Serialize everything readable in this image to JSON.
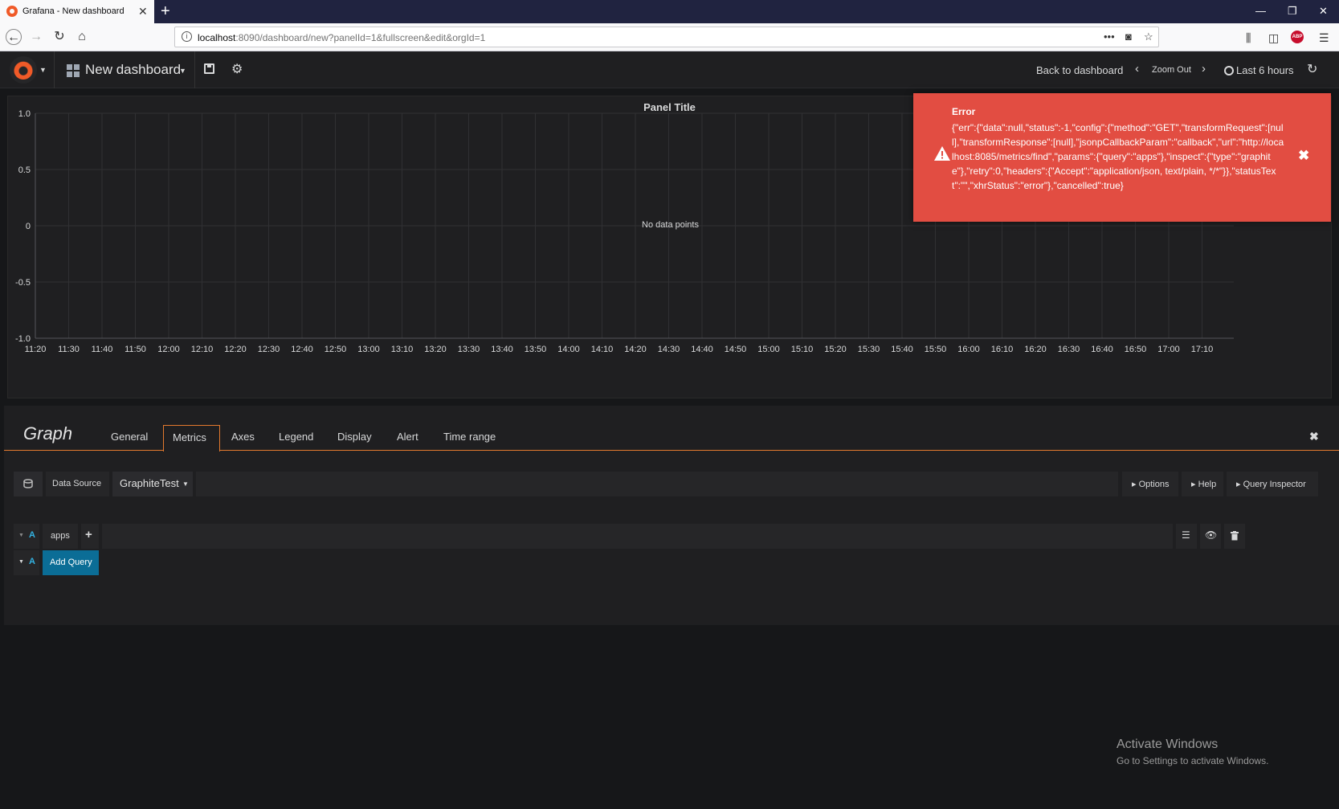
{
  "browser": {
    "tab_title": "Grafana - New dashboard",
    "url_host": "localhost",
    "url_path": ":8090/dashboard/new?panelId=1&fullscreen&edit&orgId=1",
    "addon_badge": "ABP"
  },
  "grafana_nav": {
    "dashboard_title": "New dashboard",
    "back_to_dashboard": "Back to dashboard",
    "zoom_out": "Zoom Out",
    "time_range": "Last 6 hours"
  },
  "panel": {
    "title": "Panel Title",
    "no_data": "No data points"
  },
  "chart_data": {
    "type": "line",
    "title": "Panel Title",
    "series": [],
    "y_ticks": [
      "1.0",
      "0.5",
      "0",
      "-0.5",
      "-1.0"
    ],
    "x_ticks": [
      "11:20",
      "11:30",
      "11:40",
      "11:50",
      "12:00",
      "12:10",
      "12:20",
      "12:30",
      "12:40",
      "12:50",
      "13:00",
      "13:10",
      "13:20",
      "13:30",
      "13:40",
      "13:50",
      "14:00",
      "14:10",
      "14:20",
      "14:30",
      "14:40",
      "14:50",
      "15:00",
      "15:10",
      "15:20",
      "15:30",
      "15:40",
      "15:50",
      "16:00",
      "16:10",
      "16:20",
      "16:30",
      "16:40",
      "16:50",
      "17:00",
      "17:10"
    ],
    "ylim": [
      -1.0,
      1.0
    ],
    "grid": true
  },
  "alert": {
    "title": "Error",
    "message": "{\"err\":{\"data\":null,\"status\":-1,\"config\":{\"method\":\"GET\",\"transformRequest\":[null],\"transformResponse\":[null],\"jsonpCallbackParam\":\"callback\",\"url\":\"http://localhost:8085/metrics/find\",\"params\":{\"query\":\"apps\"},\"inspect\":{\"type\":\"graphite\"},\"retry\":0,\"headers\":{\"Accept\":\"application/json, text/plain, */*\"}},\"statusText\":\"\",\"xhrStatus\":\"error\"},\"cancelled\":true}",
    "color": "#e24d42"
  },
  "editor": {
    "title": "Graph",
    "tabs": [
      "General",
      "Metrics",
      "Axes",
      "Legend",
      "Display",
      "Alert",
      "Time range"
    ],
    "active_tab": "Metrics",
    "data_source_label": "Data Source",
    "data_source_value": "GraphiteTest",
    "options_label": "Options",
    "help_label": "Help",
    "query_inspector_label": "Query Inspector",
    "query": {
      "ref": "A",
      "segment": "apps"
    },
    "add_query": {
      "ref": "A",
      "label": "Add Query"
    }
  },
  "watermark": {
    "line1": "Activate Windows",
    "line2": "Go to Settings to activate Windows."
  },
  "colors": {
    "accent": "#e3792e",
    "add_query_bg": "#0b6d96",
    "ref_blue": "#33b5e5"
  }
}
